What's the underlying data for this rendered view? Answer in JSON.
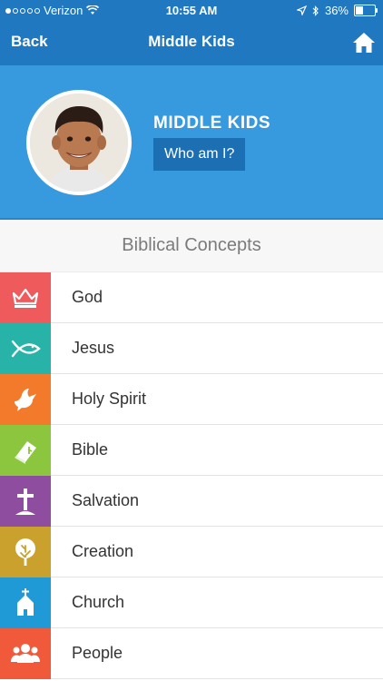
{
  "status_bar": {
    "carrier": "Verizon",
    "time": "10:55 AM",
    "battery": "36%",
    "battery_level": 0.36
  },
  "nav": {
    "back_label": "Back",
    "title": "Middle Kids",
    "home_icon": "home-icon"
  },
  "profile": {
    "name": "MIDDLE KIDS",
    "button_label": "Who am I?"
  },
  "section_title": "Biblical Concepts",
  "items": [
    {
      "label": "God",
      "color": "#ef5a5c",
      "icon": "crown-icon"
    },
    {
      "label": "Jesus",
      "color": "#27b3a8",
      "icon": "fish-icon"
    },
    {
      "label": "Holy Spirit",
      "color": "#f37a2a",
      "icon": "dove-icon"
    },
    {
      "label": "Bible",
      "color": "#8cc63f",
      "icon": "bible-icon"
    },
    {
      "label": "Salvation",
      "color": "#8e4d9f",
      "icon": "cross-icon"
    },
    {
      "label": "Creation",
      "color": "#c9a12c",
      "icon": "tree-icon"
    },
    {
      "label": "Church",
      "color": "#1f9ad6",
      "icon": "church-icon"
    },
    {
      "label": "People",
      "color": "#f05a3a",
      "icon": "people-icon"
    }
  ]
}
